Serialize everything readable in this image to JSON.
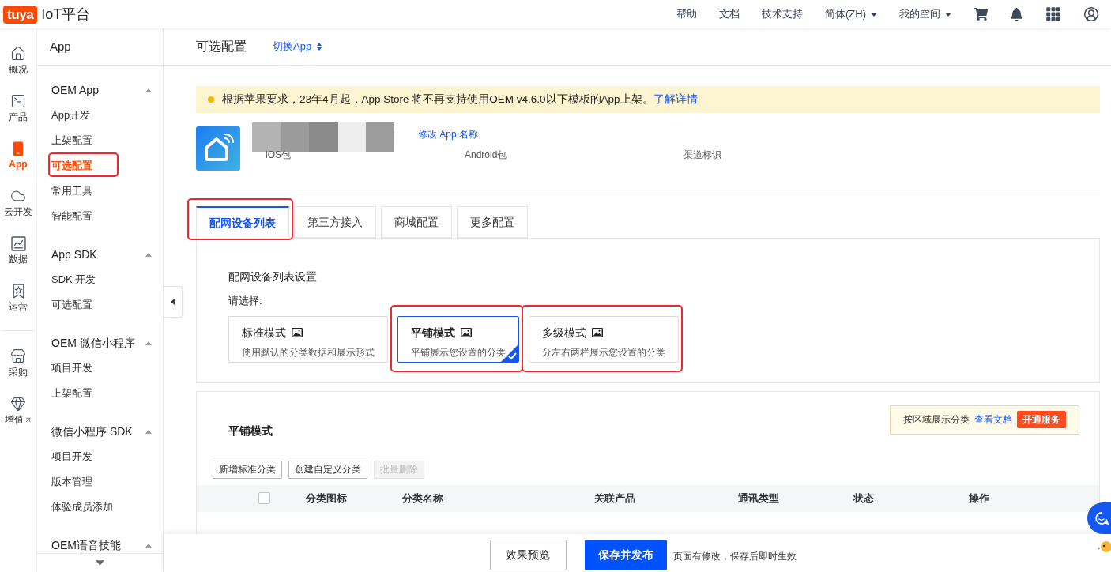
{
  "top_bar": {
    "logo": "tuya",
    "product": "IoT平台",
    "nav": [
      {
        "label": "帮助",
        "kind": "link"
      },
      {
        "label": "文档",
        "kind": "link"
      },
      {
        "label": "技术支持",
        "kind": "link"
      },
      {
        "label": "简体(ZH)",
        "kind": "dropdown"
      },
      {
        "label": "我的空间",
        "kind": "dropdown"
      }
    ]
  },
  "icon_rail": {
    "primary": [
      {
        "label": "概况",
        "selected": false
      },
      {
        "label": "产品",
        "selected": false
      },
      {
        "label": "App",
        "selected": true
      },
      {
        "label": "云开发",
        "selected": false
      },
      {
        "label": "数据",
        "selected": false
      },
      {
        "label": "运营",
        "selected": false
      }
    ],
    "secondary": [
      {
        "label": "采购",
        "selected": false,
        "external": false
      },
      {
        "label": "增值",
        "selected": false,
        "external": true
      }
    ]
  },
  "sidebar": {
    "title": "App",
    "groups": [
      {
        "title": "OEM App",
        "expanded": true,
        "items": [
          {
            "label": "App开发",
            "selected": false,
            "annotated": false
          },
          {
            "label": "上架配置",
            "selected": false,
            "annotated": false
          },
          {
            "label": "可选配置",
            "selected": true,
            "annotated": true
          },
          {
            "label": "常用工具",
            "selected": false,
            "annotated": false
          },
          {
            "label": "智能配置",
            "selected": false,
            "annotated": false
          }
        ]
      },
      {
        "title": "App SDK",
        "expanded": true,
        "items": [
          {
            "label": "SDK 开发",
            "selected": false,
            "annotated": false
          },
          {
            "label": "可选配置",
            "selected": false,
            "annotated": false
          }
        ]
      },
      {
        "title": "OEM 微信小程序",
        "expanded": true,
        "items": [
          {
            "label": "项目开发",
            "selected": false,
            "annotated": false
          },
          {
            "label": "上架配置",
            "selected": false,
            "annotated": false
          }
        ]
      },
      {
        "title": "微信小程序 SDK",
        "expanded": true,
        "items": [
          {
            "label": "项目开发",
            "selected": false,
            "annotated": false
          },
          {
            "label": "版本管理",
            "selected": false,
            "annotated": false
          },
          {
            "label": "体验成员添加",
            "selected": false,
            "annotated": false
          }
        ]
      },
      {
        "title": "OEM语音技能",
        "expanded": true
      }
    ]
  },
  "page_header": {
    "title": "可选配置",
    "switch_app": "切换App"
  },
  "notice": {
    "text": "根据苹果要求，23年4月起，App Store 将不再支持使用OEM v4.6.0以下模板的App上架。",
    "link": "了解详情"
  },
  "app_info": {
    "rename_link": "修改 App 名称",
    "fields": [
      "iOS包",
      "Android包",
      "渠道标识"
    ]
  },
  "tabs": [
    {
      "label": "配网设备列表",
      "selected": true,
      "annotated": true
    },
    {
      "label": "第三方接入",
      "selected": false,
      "annotated": false
    },
    {
      "label": "商城配置",
      "selected": false,
      "annotated": false
    },
    {
      "label": "更多配置",
      "selected": false,
      "annotated": false
    }
  ],
  "list_settings": {
    "title": "配网设备列表设置",
    "prompt": "请选择:",
    "modes": [
      {
        "title": "标准模式",
        "description": "使用默认的分类数据和展示形式",
        "selected": false,
        "annotated": false
      },
      {
        "title": "平铺模式",
        "description": "平铺展示您设置的分类",
        "selected": true,
        "annotated": true
      },
      {
        "title": "多级模式",
        "description": "分左右两栏展示您设置的分类",
        "selected": false,
        "annotated": true
      }
    ]
  },
  "category_panel": {
    "title": "平铺模式",
    "promo": {
      "text": "按区域展示分类",
      "link": "查看文档",
      "button": "开通服务"
    },
    "actions": [
      {
        "label": "新增标准分类",
        "disabled": false
      },
      {
        "label": "创建自定义分类",
        "disabled": false
      },
      {
        "label": "批量删除",
        "disabled": true
      }
    ],
    "table": {
      "select_all": {
        "checked": false
      },
      "columns": [
        "分类图标",
        "分类名称",
        "关联产品",
        "通讯类型",
        "状态",
        "操作"
      ]
    }
  },
  "footer": {
    "preview_button": "效果预览",
    "publish_button": "保存并发布",
    "hint": "页面有修改，保存后即时生效"
  }
}
